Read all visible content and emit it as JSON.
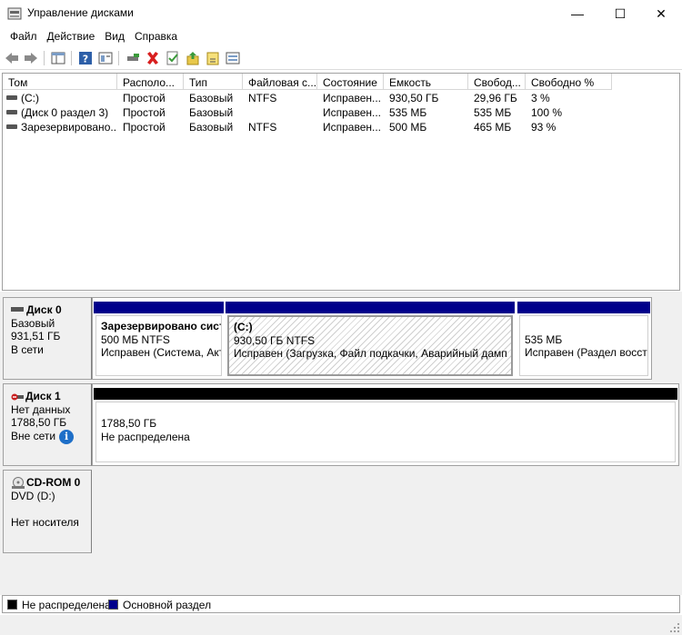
{
  "window": {
    "title": "Управление дисками",
    "minimize_glyph": "—",
    "maximize_glyph": "☐",
    "close_glyph": "✕"
  },
  "menu": [
    "Файл",
    "Действие",
    "Вид",
    "Справка"
  ],
  "toolbar_icons": [
    "back-icon",
    "forward-icon",
    "console-tree-icon",
    "help-icon",
    "show-hide-icon",
    "connect-icon",
    "delete-icon",
    "properties-icon",
    "export-icon",
    "refresh-icon",
    "rescan-icon"
  ],
  "volume_list": {
    "columns": [
      "Том",
      "Располо...",
      "Тип",
      "Файловая с...",
      "Состояние",
      "Емкость",
      "Свобод...",
      "Свободно %"
    ],
    "rows": [
      [
        "(C:)",
        "Простой",
        "Базовый",
        "NTFS",
        "Исправен...",
        "930,50 ГБ",
        "29,96 ГБ",
        "3 %"
      ],
      [
        "(Диск 0 раздел 3)",
        "Простой",
        "Базовый",
        "",
        "Исправен...",
        "535 МБ",
        "535 МБ",
        "100 %"
      ],
      [
        "Зарезервировано...",
        "Простой",
        "Базовый",
        "NTFS",
        "Исправен...",
        "500 МБ",
        "465 МБ",
        "93 %"
      ]
    ]
  },
  "disks": {
    "disk0": {
      "name": "Диск 0",
      "type": "Базовый",
      "size": "931,51 ГБ",
      "status": "В сети",
      "partitions": [
        {
          "name": "Зарезервировано систе",
          "line2": "500 МБ NTFS",
          "line3": "Исправен (Система, Акти"
        },
        {
          "name": "(C:)",
          "line2": "930,50 ГБ NTFS",
          "line3": "Исправен (Загрузка, Файл подкачки, Аварийный дамп па"
        },
        {
          "name": "",
          "line2": "535 МБ",
          "line3": "Исправен (Раздел восстан"
        }
      ]
    },
    "disk1": {
      "name": "Диск 1",
      "type": "Нет данных",
      "size": "1788,50 ГБ",
      "status": "Вне сети",
      "info_glyph": "i",
      "partition": {
        "line1": "1788,50 ГБ",
        "line2": "Не распределена"
      }
    },
    "cdrom0": {
      "name": "CD-ROM 0",
      "type": "DVD (D:)",
      "status": "Нет носителя"
    }
  },
  "legend": [
    {
      "label": "Не распределена",
      "color": "#000000"
    },
    {
      "label": "Основной раздел",
      "color": "#00008b"
    }
  ],
  "colors": {
    "primary_partition": "#00008b",
    "unallocated": "#000000",
    "info_blue": "#1e6fc8"
  }
}
